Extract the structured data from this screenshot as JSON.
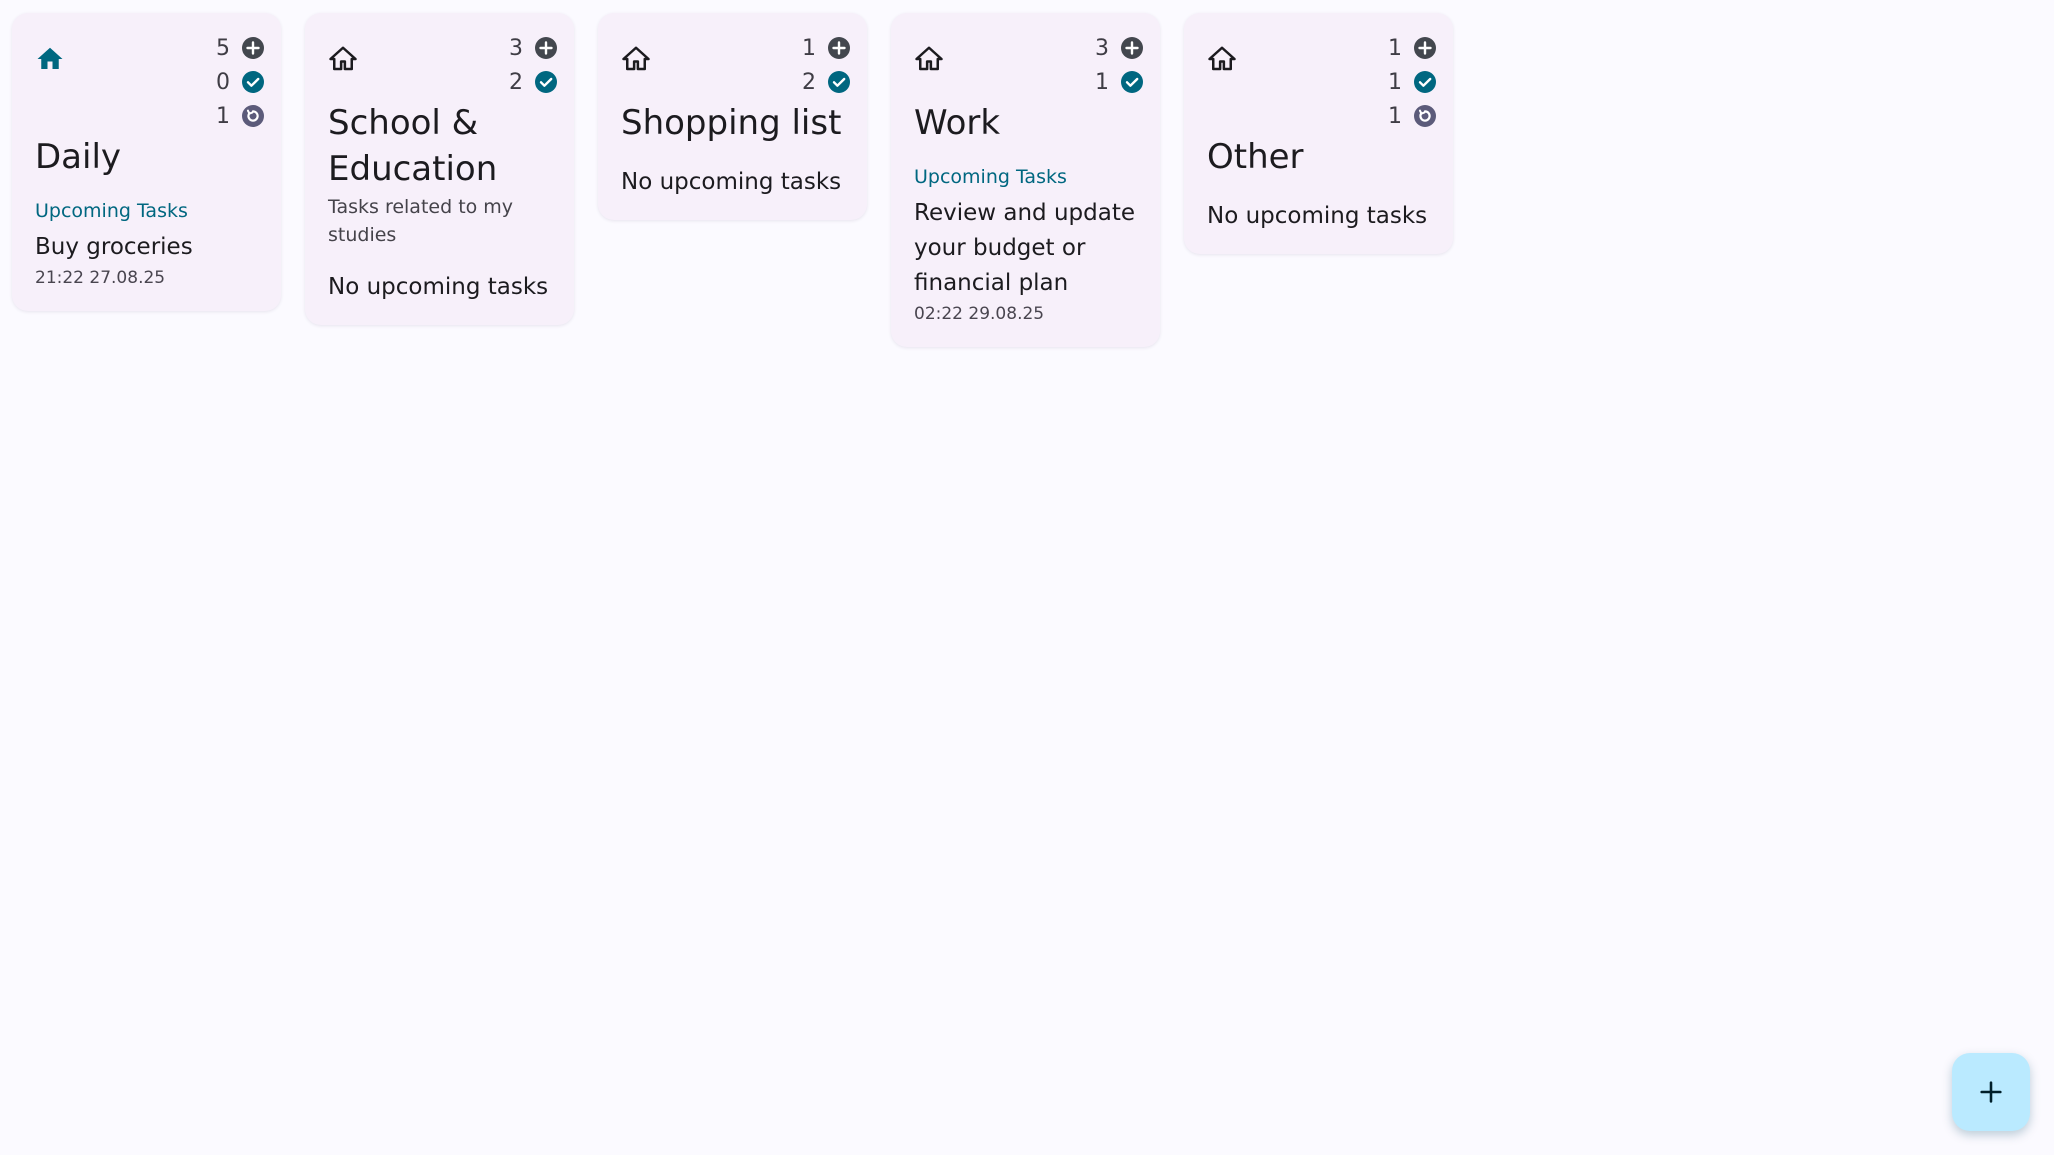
{
  "colors": {
    "background": "#fbfaff",
    "card": "#f7f0fa",
    "accent": "#006780",
    "active_home_icon": "#006780",
    "inactive_home_icon": "#1c1b1f",
    "count_badge": "#43474e",
    "completed_badge": "#006780",
    "fab": "#baeaff"
  },
  "categories": [
    {
      "title": "Daily",
      "description": "",
      "icon": "home-filled-icon",
      "counts": {
        "open": "5",
        "completed": "0",
        "recurring": "1"
      },
      "upcoming_label": "Upcoming Tasks",
      "upcoming": [
        {
          "title": "Buy groceries",
          "time": "21:22 27.08.25"
        }
      ],
      "empty_text": ""
    },
    {
      "title": "School & Education",
      "description": "Tasks related to my studies",
      "icon": "home-outline-icon",
      "counts": {
        "open": "3",
        "completed": "2"
      },
      "upcoming_label": "",
      "upcoming": [],
      "empty_text": "No upcoming tasks"
    },
    {
      "title": "Shopping list",
      "description": "",
      "icon": "home-outline-icon",
      "counts": {
        "open": "1",
        "completed": "2"
      },
      "upcoming_label": "",
      "upcoming": [],
      "empty_text": "No upcoming tasks"
    },
    {
      "title": "Work",
      "description": "",
      "icon": "home-outline-icon",
      "counts": {
        "open": "3",
        "completed": "1"
      },
      "upcoming_label": "Upcoming Tasks",
      "upcoming": [
        {
          "title": "Review and update your budget or financial plan",
          "time": "02:22 29.08.25"
        }
      ],
      "empty_text": ""
    },
    {
      "title": "Other",
      "description": "",
      "icon": "home-outline-icon",
      "counts": {
        "open": "1",
        "completed": "1",
        "recurring": "1"
      },
      "upcoming_label": "",
      "upcoming": [],
      "empty_text": "No upcoming tasks"
    }
  ],
  "fab": {
    "icon": "plus-icon"
  }
}
